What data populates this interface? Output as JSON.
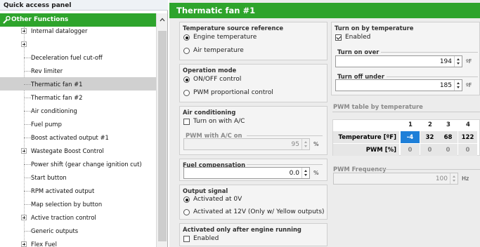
{
  "quick_access": {
    "title": "Quick access panel",
    "header": "Other Functions",
    "items": [
      {
        "label": "Internal datalogger",
        "expandable": true,
        "selected": false
      },
      {
        "label": "",
        "expandable": true,
        "selected": false
      },
      {
        "label": "Deceleration fuel cut-off",
        "expandable": false,
        "selected": false
      },
      {
        "label": "Rev limiter",
        "expandable": false,
        "selected": false
      },
      {
        "label": "Thermatic fan #1",
        "expandable": false,
        "selected": true
      },
      {
        "label": "Thermatic fan #2",
        "expandable": false,
        "selected": false
      },
      {
        "label": "Air conditioning",
        "expandable": false,
        "selected": false
      },
      {
        "label": "Fuel pump",
        "expandable": false,
        "selected": false
      },
      {
        "label": "Boost activated output #1",
        "expandable": false,
        "selected": false
      },
      {
        "label": "Wastegate Boost Control",
        "expandable": true,
        "selected": false
      },
      {
        "label": "Power shift (gear change ignition cut)",
        "expandable": false,
        "selected": false
      },
      {
        "label": "Start button",
        "expandable": false,
        "selected": false
      },
      {
        "label": "RPM activated output",
        "expandable": false,
        "selected": false
      },
      {
        "label": "Map selection by button",
        "expandable": false,
        "selected": false
      },
      {
        "label": "Active traction control",
        "expandable": true,
        "selected": false
      },
      {
        "label": "Generic outputs",
        "expandable": false,
        "selected": false
      },
      {
        "label": "Flex Fuel",
        "expandable": true,
        "selected": false
      }
    ]
  },
  "panel": {
    "title": "Thermatic fan #1",
    "temp_source": {
      "title": "Temperature source reference",
      "options": [
        "Engine temperature",
        "Air temperature"
      ],
      "selected": 0
    },
    "operation_mode": {
      "title": "Operation mode",
      "options": [
        "ON/OFF control",
        "PWM proportional control"
      ],
      "selected": 0
    },
    "air_conditioning": {
      "title": "Air conditioning",
      "turn_on_label": "Turn on with A/C",
      "turn_on_checked": false,
      "pwm_label": "PWM with A/C on",
      "pwm_value": "95",
      "pwm_unit": "%"
    },
    "fuel_compensation": {
      "title": "Fuel compensation",
      "value": "0.0",
      "unit": "%"
    },
    "output_signal": {
      "title": "Output signal",
      "options": [
        "Activated at 0V",
        "Activated at 12V (Only w/ Yellow outputs)"
      ],
      "selected": 0
    },
    "after_engine": {
      "title": "Activated only after engine running",
      "label": "Enabled",
      "checked": false
    },
    "turn_on_temp": {
      "title": "Turn on by temperature",
      "enabled_label": "Enabled",
      "enabled_checked": true,
      "on_over_label": "Turn on over",
      "on_over_value": "194",
      "off_under_label": "Turn off under",
      "off_under_value": "185",
      "unit": "ºF"
    },
    "pwm_table": {
      "title": "PWM table by temperature",
      "columns": [
        "1",
        "2",
        "3",
        "4"
      ],
      "rows": [
        {
          "label": "Temperature [ºF]",
          "values": [
            "-4",
            "32",
            "68",
            "122"
          ]
        },
        {
          "label": "PWM [%]",
          "values": [
            "0",
            "0",
            "0",
            "0"
          ]
        }
      ]
    },
    "pwm_frequency": {
      "title": "PWM Frequency",
      "value": "100",
      "unit": "Hz"
    }
  },
  "colors": {
    "header_green": "#2ea42c",
    "selected_cell": "#1e7fd8"
  }
}
